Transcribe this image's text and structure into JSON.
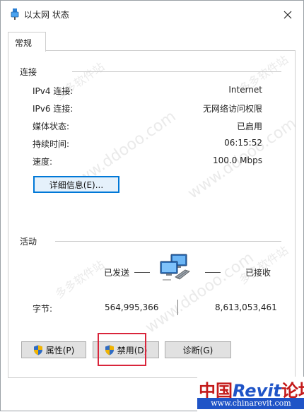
{
  "window": {
    "title": "以太网 状态",
    "close_label": "✕"
  },
  "tabs": [
    {
      "label": "常规"
    }
  ],
  "connection": {
    "group_label": "连接",
    "rows": [
      {
        "label": "IPv4 连接:",
        "value": "Internet"
      },
      {
        "label": "IPv6 连接:",
        "value": "无网络访问权限"
      },
      {
        "label": "媒体状态:",
        "value": "已启用"
      },
      {
        "label": "持续时间:",
        "value": "06:15:52"
      },
      {
        "label": "速度:",
        "value": "100.0 Mbps"
      }
    ],
    "details_button": "详细信息(E)..."
  },
  "activity": {
    "group_label": "活动",
    "sent_label": "已发送",
    "received_label": "已接收",
    "bytes_label": "字节:",
    "bytes_sent": "564,995,366",
    "bytes_received": "8,613,053,461"
  },
  "buttons": {
    "properties": "属性(P)",
    "disable": "禁用(D)",
    "diagnose": "诊断(G)"
  },
  "watermark": {
    "site_text": "www.ddooo.com",
    "site_cn": "多多软件站",
    "brand_main_a": "中国",
    "brand_main_b": "Revit",
    "brand_main_c": "论坛",
    "brand_url": "www.chinarevit.com"
  },
  "colors": {
    "accent": "#0078d7",
    "highlight": "#d9253b",
    "button_bg": "#e1e1e1"
  }
}
